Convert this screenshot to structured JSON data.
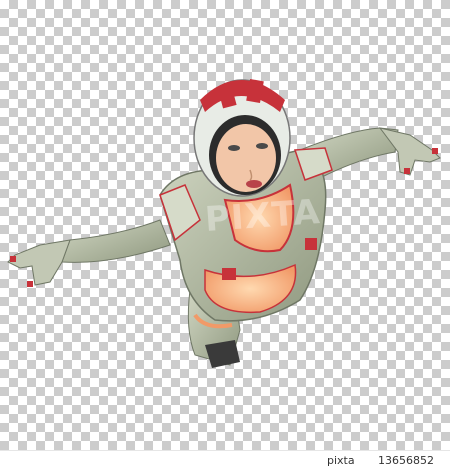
{
  "image": {
    "watermark_text": "PIXTA",
    "footer": {
      "logo_text": "pixta",
      "id_text": "13656852"
    }
  },
  "colors": {
    "suit": "#b9c1a8",
    "suit_shadow": "#8d9581",
    "armor_red": "#c7323a",
    "helmet_white": "#e8ece6",
    "skin": "#f2c6a8",
    "glow": "#f7b07a"
  }
}
